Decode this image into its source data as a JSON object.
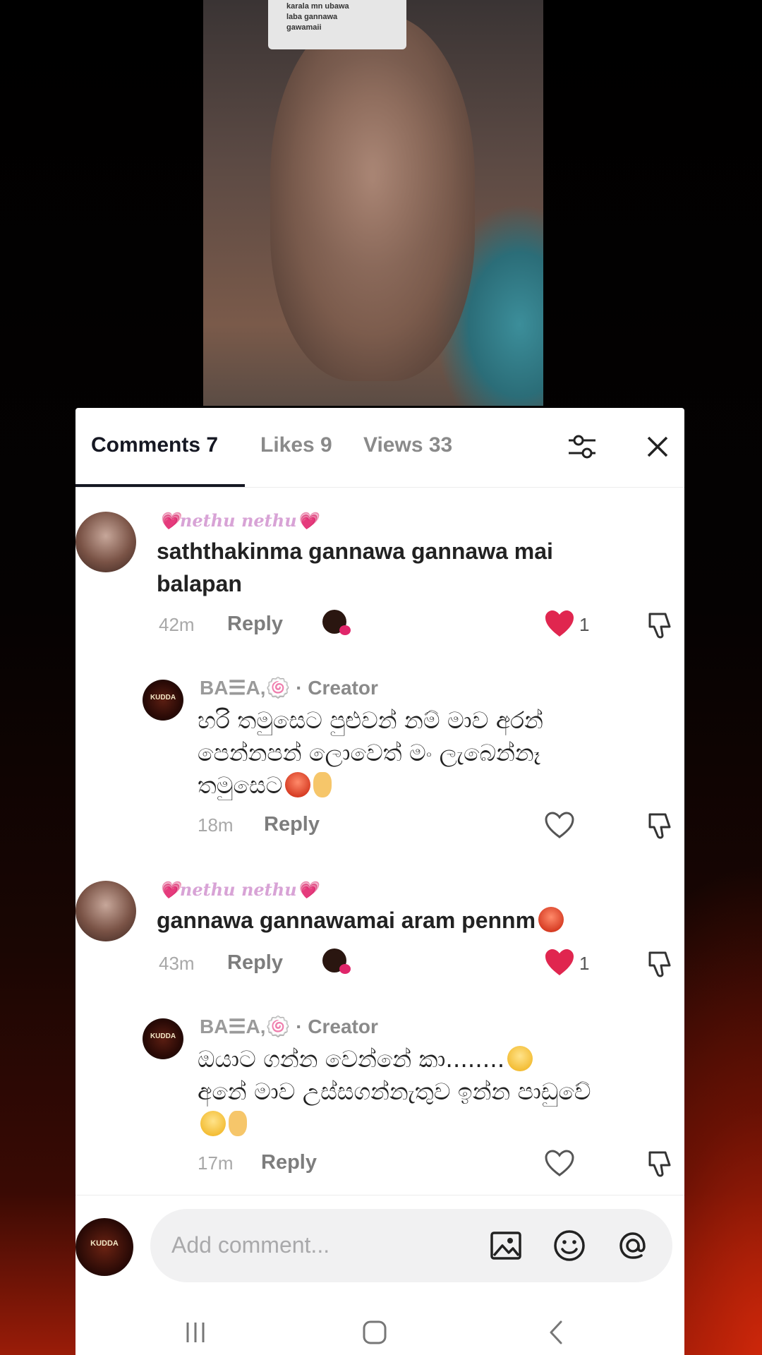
{
  "photo": {
    "caption_lines": [
      "karala mn ubawa",
      "laba gannawa",
      "gawamaii"
    ]
  },
  "tabs": [
    {
      "label": "Comments 7",
      "active": true
    },
    {
      "label": "Likes 9",
      "active": false
    },
    {
      "label": "Views 33",
      "active": false
    }
  ],
  "comments": [
    {
      "username": "💗nethu nethu💗",
      "text_line1": "saththakinma gannawa gannawa mai",
      "text_line2": "balapan",
      "time": "42m",
      "reply_label": "Reply",
      "likes": "1"
    },
    {
      "username": "BA☰A,🍥",
      "creator_tag": "· Creator",
      "text_line1": "හරි තමුසෙට පුළුවන් නම් මාව අරන්",
      "text_line2": "පෙන්නපන් ලොවෙත් මං ලැබෙන්නෑ",
      "text_line3": "තමුසෙට",
      "time": "18m",
      "reply_label": "Reply"
    },
    {
      "username": "💗nethu nethu💗",
      "text_line1": "gannawa gannawamai aram pennm",
      "time": "43m",
      "reply_label": "Reply",
      "likes": "1"
    },
    {
      "username": "BA☰A,🍥",
      "creator_tag": "· Creator",
      "text_line1": "ඔයාට ගන්න වෙන්නේ කා........",
      "text_line2": "අනේ මාව උස්සගන්නැතුව ඉන්න පාඩුවේ",
      "time": "17m",
      "reply_label": "Reply"
    }
  ],
  "composer": {
    "placeholder": "Add comment...",
    "avatar_text": "KUDDA"
  },
  "creator_avatar_text": "KUDDA",
  "icons": {
    "filter": "sliders-icon",
    "close": "close-icon",
    "image": "image-icon",
    "emoji": "emoji-icon",
    "mention": "at-icon"
  },
  "colors": {
    "like_red": "#e0264f",
    "username_pink": "#d8a3d6"
  }
}
